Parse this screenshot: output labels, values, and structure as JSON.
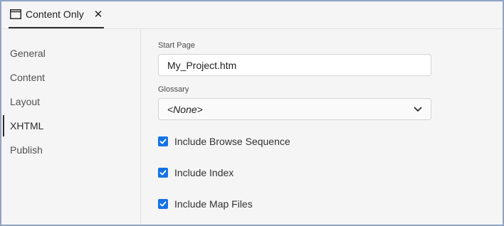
{
  "tab": {
    "label": "Content Only",
    "close_glyph": "✕",
    "icon": "window-icon"
  },
  "sidebar": {
    "items": [
      {
        "label": "General",
        "active": false
      },
      {
        "label": "Content",
        "active": false
      },
      {
        "label": "Layout",
        "active": false
      },
      {
        "label": "XHTML",
        "active": true
      },
      {
        "label": "Publish",
        "active": false
      }
    ]
  },
  "form": {
    "start_page": {
      "label": "Start Page",
      "value": "My_Project.htm"
    },
    "glossary": {
      "label": "Glossary",
      "selected": "<None>"
    },
    "checkboxes": [
      {
        "label": "Include Browse Sequence",
        "checked": true
      },
      {
        "label": "Include Index",
        "checked": true
      },
      {
        "label": "Include Map Files",
        "checked": true
      }
    ]
  },
  "colors": {
    "accent": "#1473e6",
    "border": "#8fa3c5",
    "background": "#f5f5f5"
  }
}
